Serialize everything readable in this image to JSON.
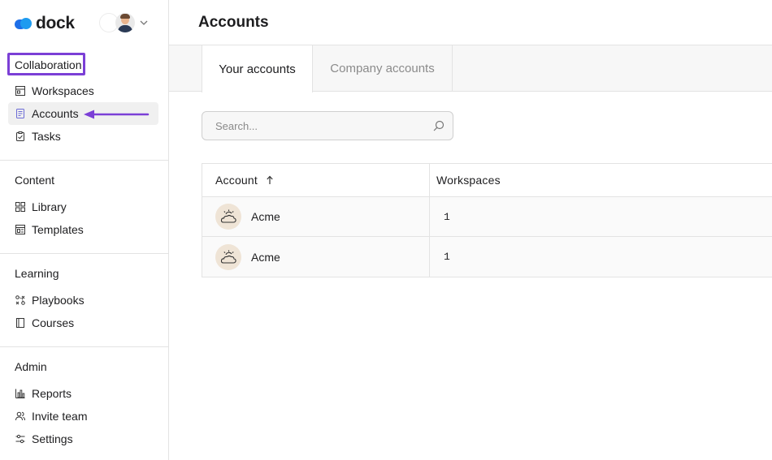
{
  "app": {
    "brand_name": "dock",
    "brand_color": "#1d6fe8",
    "accent_highlight": "#7b3fd6"
  },
  "sidebar": {
    "sections": [
      {
        "title": "Collaboration",
        "items": [
          {
            "label": "Workspaces",
            "icon": "workspaces-icon"
          },
          {
            "label": "Accounts",
            "icon": "accounts-icon",
            "active": true
          },
          {
            "label": "Tasks",
            "icon": "tasks-icon"
          }
        ]
      },
      {
        "title": "Content",
        "items": [
          {
            "label": "Library",
            "icon": "library-icon"
          },
          {
            "label": "Templates",
            "icon": "templates-icon"
          }
        ]
      },
      {
        "title": "Learning",
        "items": [
          {
            "label": "Playbooks",
            "icon": "playbooks-icon"
          },
          {
            "label": "Courses",
            "icon": "courses-icon"
          }
        ]
      },
      {
        "title": "Admin",
        "items": [
          {
            "label": "Reports",
            "icon": "reports-icon"
          },
          {
            "label": "Invite team",
            "icon": "invite-team-icon"
          },
          {
            "label": "Settings",
            "icon": "settings-icon"
          }
        ]
      }
    ]
  },
  "main": {
    "title": "Accounts",
    "tabs": [
      {
        "label": "Your accounts",
        "active": true
      },
      {
        "label": "Company accounts",
        "active": false
      }
    ],
    "search": {
      "placeholder": "Search...",
      "value": ""
    },
    "table": {
      "columns": [
        "Account",
        "Workspaces"
      ],
      "sort_column": "Account",
      "sort_direction": "ascending",
      "rows": [
        {
          "account": "Acme",
          "workspaces": "1"
        },
        {
          "account": "Acme",
          "workspaces": "1"
        }
      ]
    }
  }
}
